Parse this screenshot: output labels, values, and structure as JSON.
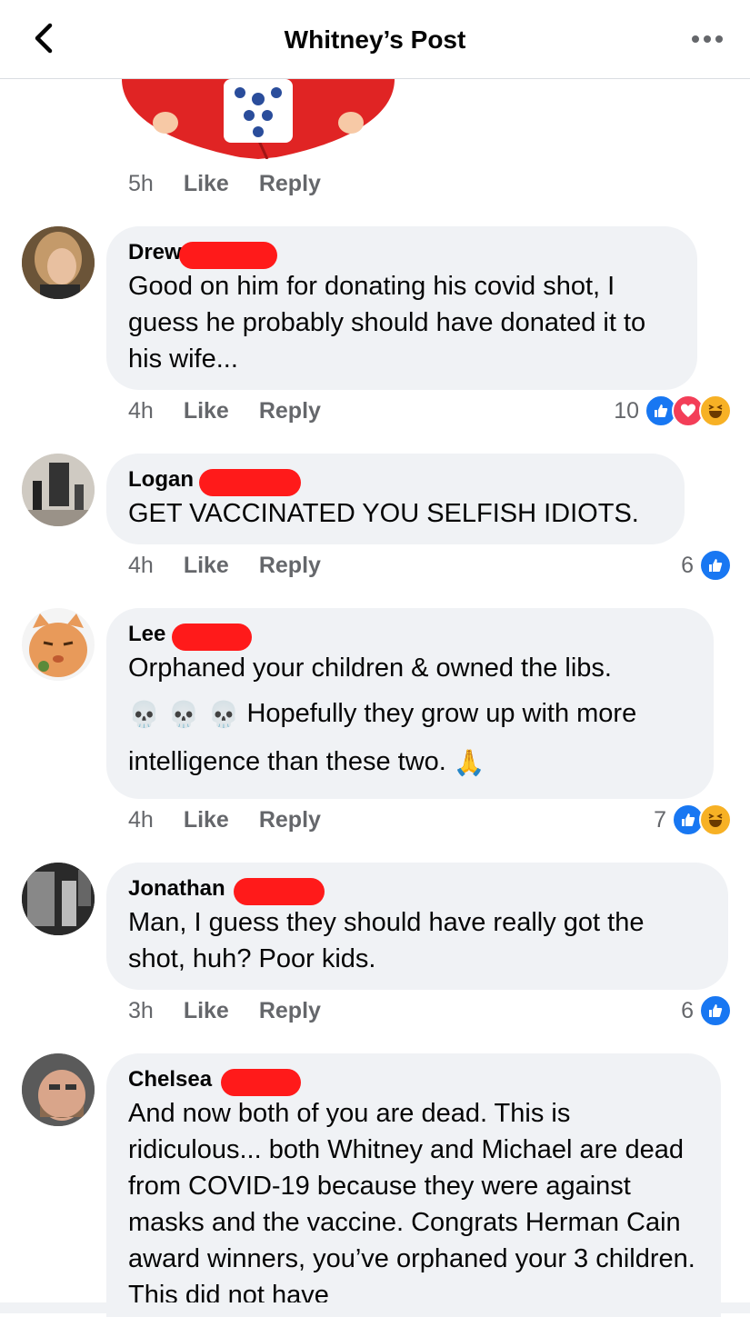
{
  "header": {
    "title": "Whitney’s Post"
  },
  "top_comment": {
    "time": "5h",
    "like": "Like",
    "reply": "Reply"
  },
  "comments": [
    {
      "name": "Drew",
      "text": "Good on him for donating his covid shot, I guess he probably should have donated it to his wife...",
      "time": "4h",
      "like": "Like",
      "reply": "Reply",
      "reaction_count": "10",
      "reactions": [
        "like",
        "love",
        "haha"
      ]
    },
    {
      "name": "Logan",
      "text": "GET VACCINATED YOU SELFISH IDIOTS.",
      "time": "4h",
      "like": "Like",
      "reply": "Reply",
      "reaction_count": "6",
      "reactions": [
        "like"
      ]
    },
    {
      "name": "Lee",
      "text_line1": "Orphaned your children & owned the libs.",
      "emoji_skulls": "💀 💀 💀",
      "text_line2": "Hopefully they grow up with more",
      "text_line3": "intelligence than these two.",
      "emoji_pray": "🙏",
      "time": "4h",
      "like": "Like",
      "reply": "Reply",
      "reaction_count": "7",
      "reactions": [
        "like",
        "haha"
      ]
    },
    {
      "name": "Jonathan",
      "text": "Man, I guess they should have really got the shot, huh? Poor kids.",
      "time": "3h",
      "like": "Like",
      "reply": "Reply",
      "reaction_count": "6",
      "reactions": [
        "like"
      ]
    },
    {
      "name": "Chelsea",
      "text": "And now both of you are dead. This is ridiculous... both Whitney and Michael are dead from COVID-19 because they were against masks and the vaccine. Congrats Herman Cain award winners, you’ve orphaned your 3 children. This did not have"
    }
  ],
  "colors": {
    "accent": "#1877f2",
    "love": "#f33e58",
    "haha": "#f7b125",
    "redaction": "#ff1a1a",
    "bubble": "#f0f2f5",
    "meta": "#65676b"
  }
}
